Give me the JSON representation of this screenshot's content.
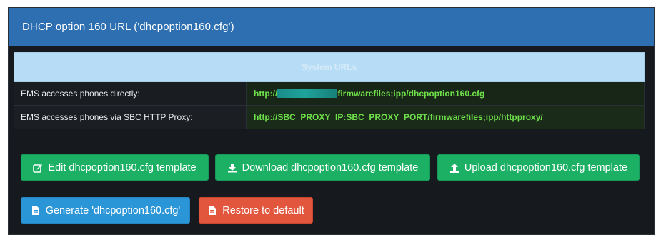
{
  "panel": {
    "title": "DHCP option 160 URL ('dhcpoption160.cfg')"
  },
  "urls": {
    "header": "System URLs",
    "rows": [
      {
        "label": "EMS accesses phones directly:",
        "value_prefix": "http://",
        "value_suffix": "firmwarefiles;ipp/dhcpoption160.cfg"
      },
      {
        "label": "EMS accesses phones via SBC HTTP Proxy:",
        "value": "http://SBC_PROXY_IP:SBC_PROXY_PORT/firmwarefiles;ipp/httpproxy/"
      }
    ]
  },
  "buttons": {
    "edit": {
      "label": "Edit dhcpoption160.cfg template",
      "icon": "edit-icon"
    },
    "download": {
      "label": "Download dhcpoption160.cfg template",
      "icon": "download-icon"
    },
    "upload": {
      "label": "Upload dhcpoption160.cfg template",
      "icon": "upload-icon"
    },
    "generate": {
      "label": "Generate 'dhcpoption160.cfg'",
      "icon": "file-icon"
    },
    "restore": {
      "label": "Restore to default",
      "icon": "file-icon"
    }
  },
  "colors": {
    "header_blue": "#2d6fb0",
    "table_header": "#b7dcf5",
    "url_green": "#6fe04a",
    "button_green": "#1bb064",
    "button_blue": "#2a96d7",
    "button_red": "#e2563d"
  }
}
